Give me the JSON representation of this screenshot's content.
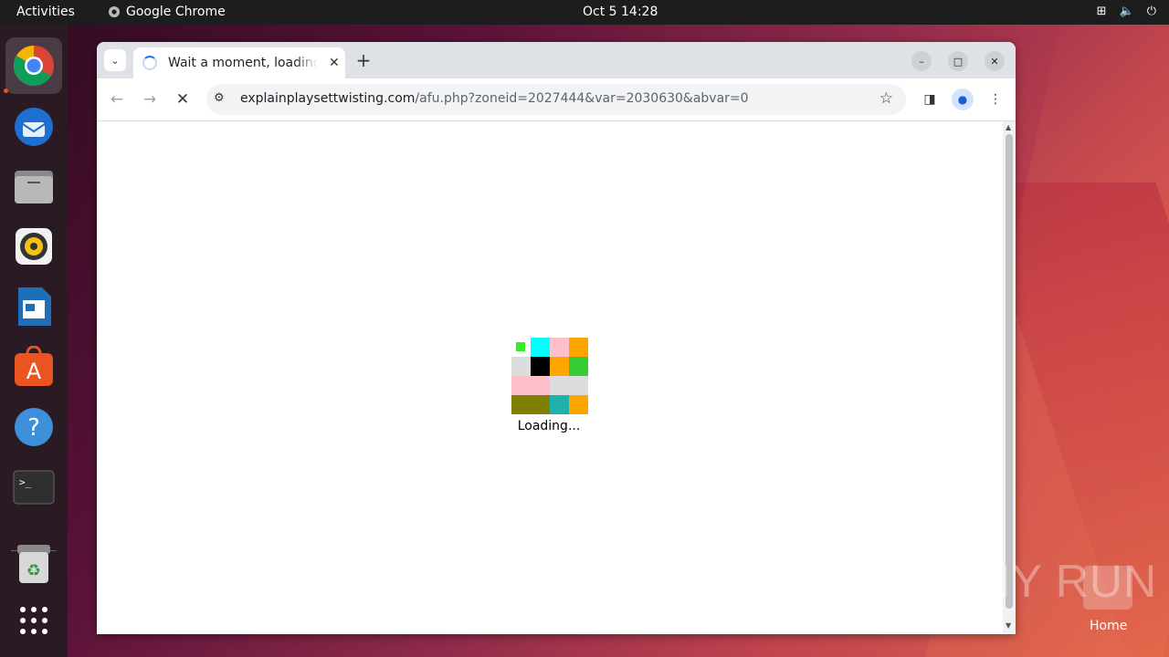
{
  "topbar": {
    "activities": "Activities",
    "app_name": "Google Chrome",
    "clock": "Oct 5  14:28"
  },
  "dock": {
    "items": [
      "chrome",
      "thunderbird",
      "files",
      "rhythmbox",
      "libreoffice-writer",
      "app-center",
      "help",
      "terminal",
      "trash",
      "show-apps"
    ]
  },
  "browser": {
    "tab_title": "Wait a moment, loading",
    "url_host": "explainplaysettwisting.com",
    "url_path": "/afu.php?zoneid=2027444&var=2030630&abvar=0"
  },
  "page": {
    "loading_text": "Loading...",
    "grid_colors": [
      [
        "#33ee22",
        "#00ffff",
        "#ffc0cb",
        "#ffa500"
      ],
      [
        "#dddddd",
        "#000000",
        "#ffa500",
        "#33cc33"
      ],
      [
        "#ffc0cb",
        "#ffc0cb",
        "#dddddd",
        "#dddddd"
      ],
      [
        "#808000",
        "#808000",
        "#20b2aa",
        "#ffa500"
      ]
    ]
  },
  "desktop": {
    "home_label": "Home",
    "watermark": "ANY RUN"
  }
}
